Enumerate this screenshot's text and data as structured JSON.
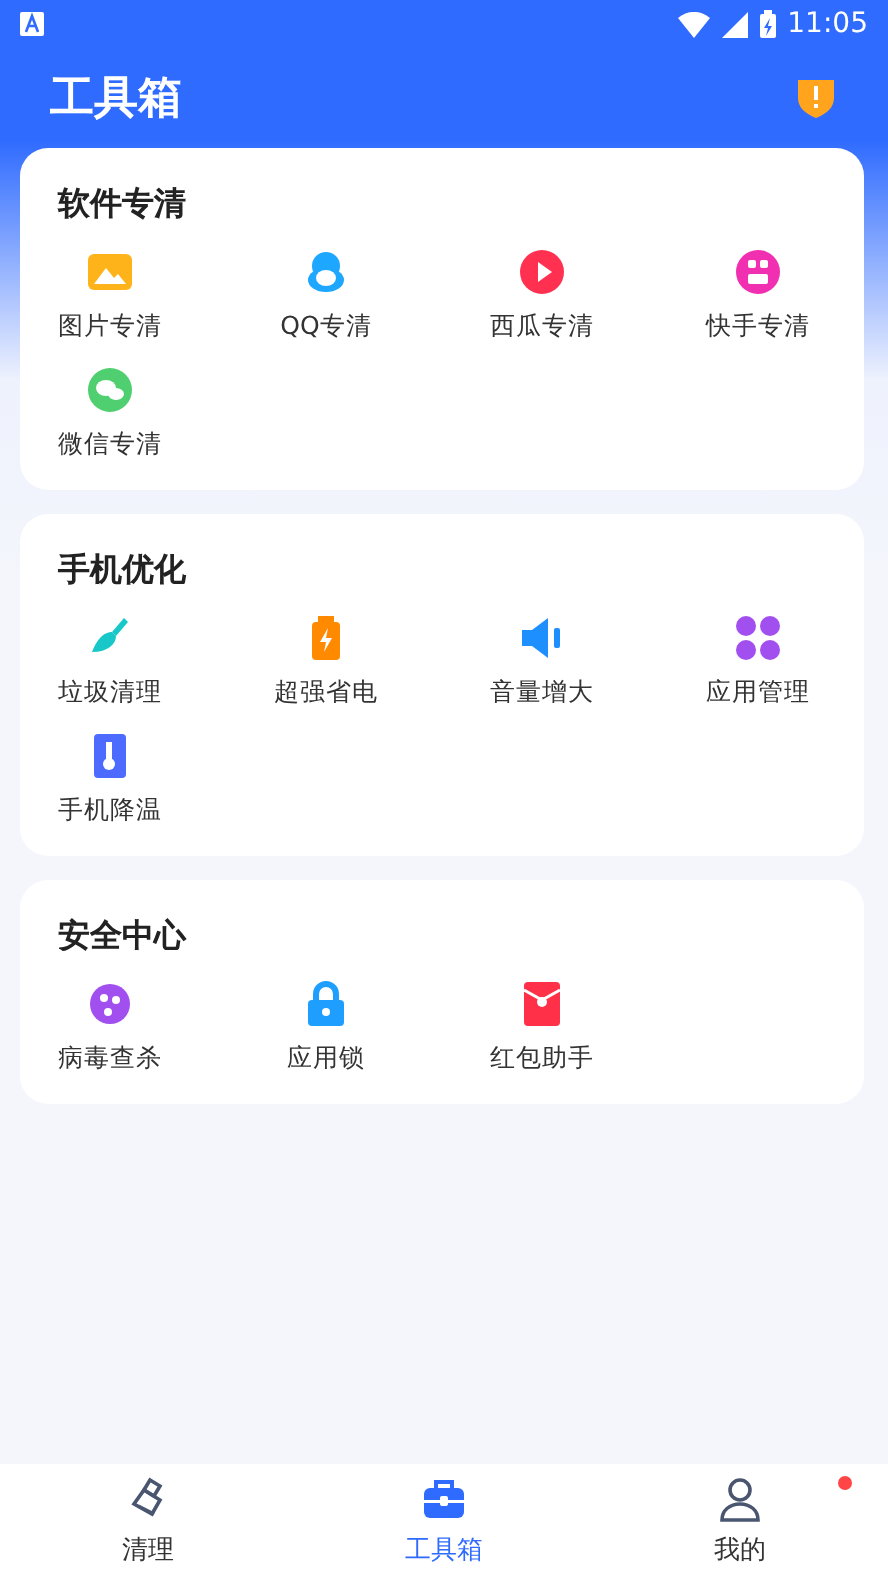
{
  "status_bar": {
    "time": "11:05"
  },
  "header": {
    "title": "工具箱"
  },
  "sections": [
    {
      "title": "软件专清",
      "items": [
        {
          "label": "图片专清",
          "kind": "picture"
        },
        {
          "label": "QQ专清",
          "kind": "penguin"
        },
        {
          "label": "西瓜专清",
          "kind": "play"
        },
        {
          "label": "快手专清",
          "kind": "kuai"
        },
        {
          "label": "微信专清",
          "kind": "chat"
        }
      ]
    },
    {
      "title": "手机优化",
      "items": [
        {
          "label": "垃圾清理",
          "kind": "broom"
        },
        {
          "label": "超强省电",
          "kind": "battery"
        },
        {
          "label": "音量增大",
          "kind": "speaker"
        },
        {
          "label": "应用管理",
          "kind": "apps"
        },
        {
          "label": "手机降温",
          "kind": "thermo"
        }
      ]
    },
    {
      "title": "安全中心",
      "items": [
        {
          "label": "病毒查杀",
          "kind": "virus"
        },
        {
          "label": "应用锁",
          "kind": "lock"
        },
        {
          "label": "红包助手",
          "kind": "envelope"
        }
      ]
    }
  ],
  "tabs": [
    {
      "label": "清理",
      "kind": "brush",
      "selected": false,
      "dot": false
    },
    {
      "label": "工具箱",
      "kind": "toolbox",
      "selected": true,
      "dot": false
    },
    {
      "label": "我的",
      "kind": "person",
      "selected": false,
      "dot": true
    }
  ]
}
